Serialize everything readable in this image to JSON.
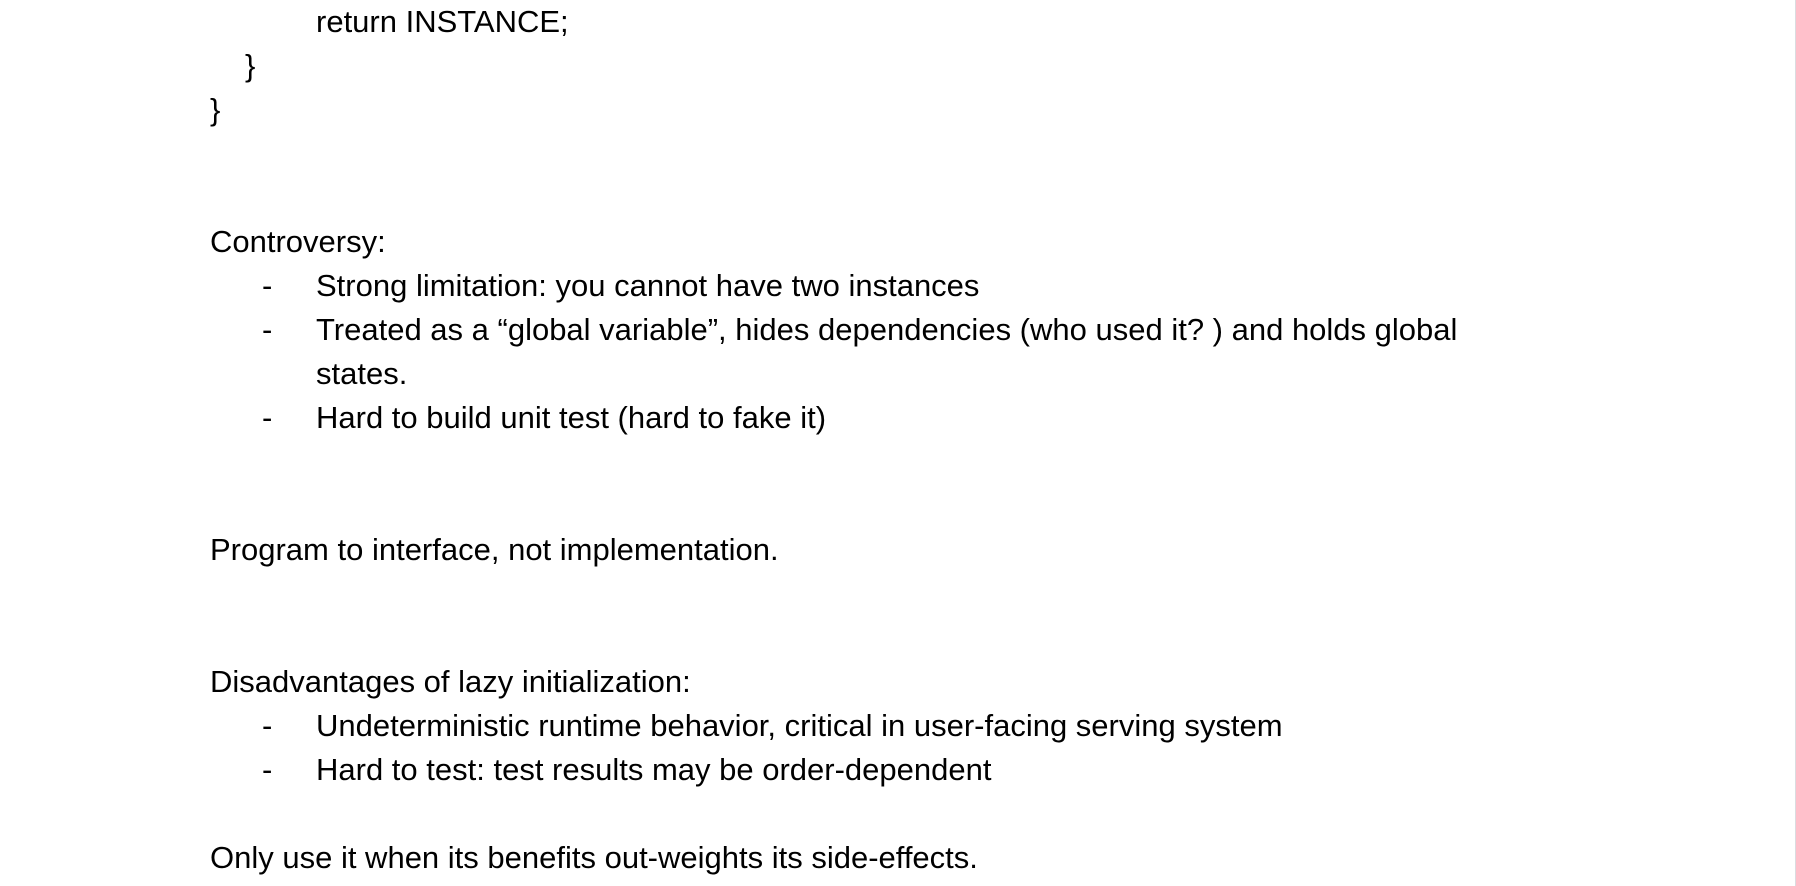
{
  "code": {
    "return_line": "return INSTANCE;",
    "inner_close": "}",
    "outer_close": "}"
  },
  "controversy": {
    "heading": "Controversy:",
    "bullet_marker": "-",
    "items": [
      "Strong limitation: you cannot have two instances",
      "Treated as a “global variable”, hides dependencies (who used it? ) and holds global",
      "states.",
      "Hard to build unit test (hard to fake it)"
    ]
  },
  "principle": {
    "text": "Program to interface, not implementation."
  },
  "lazy_init": {
    "heading": "Disadvantages of lazy initialization:",
    "bullet_marker": "-",
    "items": [
      "Undeterministic runtime behavior, critical in user-facing serving system",
      "Hard to test: test results may be order-dependent"
    ]
  },
  "conclusion": {
    "text": "Only use it when its benefits out-weights its side-effects."
  }
}
